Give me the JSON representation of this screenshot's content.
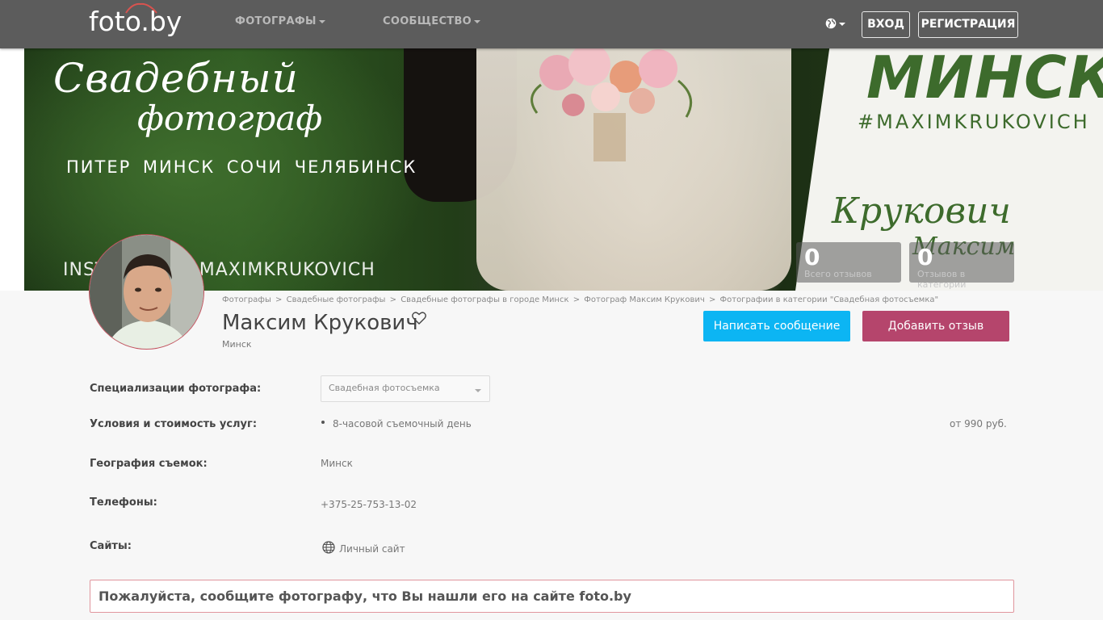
{
  "header": {
    "logo": "foto.by",
    "nav": [
      {
        "label": "ФОТОГРАФЫ"
      },
      {
        "label": "СООБЩЕСТВО"
      }
    ],
    "login_label": "ВХОД",
    "register_label": "РЕГИСТРАЦИЯ",
    "language_icon": "globe-icon"
  },
  "banner": {
    "title_line1": "Свадебный",
    "title_line2": "фотограф",
    "cities": "ПИТЕР МИНСК СОЧИ ЧЕЛЯБИНСК",
    "instagram": "INSTAGRAM @MAXIMKRUKOVICH",
    "city_big": "МИНСК",
    "hashtag": "#MAXIMKRUKOVICH",
    "signature_last": "Крукович",
    "signature_first": "Максим"
  },
  "stats": [
    {
      "value": "0",
      "label": "Всего отзывов"
    },
    {
      "value": "0",
      "label": "Отзывов в категории"
    }
  ],
  "profile": {
    "breadcrumb": [
      "Фотографы",
      "Свадебные фотографы",
      "Свадебные фотографы в городе Минск",
      "Фотограф Максим Крукович",
      "Фотографии в категории \"Свадебная фотосъемка\""
    ],
    "breadcrumb_sep": ">",
    "name": "Максим Крукович",
    "city": "Минск",
    "message_button": "Написать сообщение",
    "review_button": "Добавить отзыв"
  },
  "details": {
    "specialization_label": "Специализации фотографа:",
    "specialization_value": "Свадебная фотосъемка",
    "services_label": "Условия и стоимость услуг:",
    "service_item": "8-часовой съемочный день",
    "service_price": "от 990 руб.",
    "geo_label": "География съемок:",
    "geo_value": "Минск",
    "phones_label": "Телефоны:",
    "phone_value": "+375-25-753-13-02",
    "sites_label": "Сайты:",
    "site_value": "Личный сайт"
  },
  "notice": "Пожалуйста, сообщите фотографу, что Вы нашли его на сайте foto.by",
  "colors": {
    "header_bg": "#5c5c5c",
    "message_button": "#0cb5f3",
    "review_button": "#b5456c",
    "banner_green": "#3d6b2c"
  }
}
